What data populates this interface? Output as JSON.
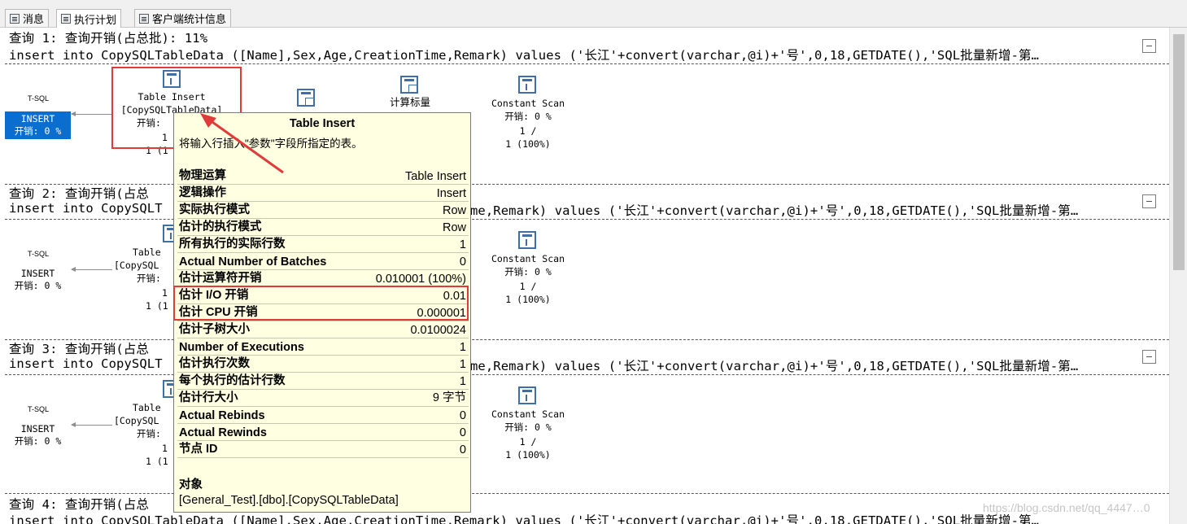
{
  "tabs": [
    {
      "label": "消息",
      "icon": "messages-icon"
    },
    {
      "label": "执行计划",
      "icon": "execution-plan-icon"
    },
    {
      "label": "客户端统计信息",
      "icon": "client-stats-icon"
    }
  ],
  "queries": [
    {
      "title": "查询 1: 查询开销(占总批): 11%",
      "sql": "insert into CopySQLTableData ([Name],Sex,Age,CreationTime,Remark) values ('长江'+convert(varchar,@i)+'号',0,18,GETDATE(),'SQL批量新增-第…"
    },
    {
      "title": "查询 2: 查询开销(占总",
      "sql_left": "insert into CopySQLT",
      "sql_right": "me,Remark) values ('长江'+convert(varchar,@i)+'号',0,18,GETDATE(),'SQL批量新增-第…"
    },
    {
      "title": "查询 3: 查询开销(占总",
      "sql_left": "insert into CopySQLT",
      "sql_right": "me,Remark) values ('长江'+convert(varchar,@i)+'号',0,18,GETDATE(),'SQL批量新增-第…"
    },
    {
      "title": "查询 4: 查询开销(占总",
      "sql_left": "insert into CopySQLTableData ([Name],Sex,Age,CreationTime,Remark) values ('长江'+convert(varchar,@i)+'号',0,18,GETDATE(),'SQL批量新增-第…"
    }
  ],
  "plan": {
    "tsql": "T-SQL",
    "insert": "INSERT",
    "insert_cost": "开销: 0 %",
    "table_insert_name": "Table Insert",
    "table_insert_obj": "[CopySQLTableData]",
    "table_insert_short": "Table",
    "table_insert_obj_short": "[CopySQL",
    "table_insert_cost": "开销:",
    "table_insert_rows_a": "1",
    "table_insert_rows_b": "1 (1",
    "compute_scalar": "计算标量",
    "constant_scan": "Constant Scan",
    "constant_cost": "开销: 0 %",
    "constant_rows_a": "1 /",
    "constant_rows_b": "1 (100%)"
  },
  "tooltip": {
    "title": "Table Insert",
    "description": "将输入行插入\"参数\"字段所指定的表。",
    "rows": [
      {
        "k": "物理运算",
        "v": "Table Insert"
      },
      {
        "k": "逻辑操作",
        "v": "Insert"
      },
      {
        "k": "实际执行模式",
        "v": "Row"
      },
      {
        "k": "估计的执行模式",
        "v": "Row"
      },
      {
        "k": "所有执行的实际行数",
        "v": "1"
      },
      {
        "k": "Actual Number of Batches",
        "v": "0"
      },
      {
        "k": "估计运算符开销",
        "v": "0.010001 (100%)"
      },
      {
        "k": "估计 I/O 开销",
        "v": "0.01"
      },
      {
        "k": "估计 CPU 开销",
        "v": "0.000001"
      },
      {
        "k": "估计子树大小",
        "v": "0.0100024"
      },
      {
        "k": "Number of Executions",
        "v": "1"
      },
      {
        "k": "估计执行次数",
        "v": "1"
      },
      {
        "k": "每个执行的估计行数",
        "v": "1"
      },
      {
        "k": "估计行大小",
        "v": "9 字节"
      },
      {
        "k": "Actual Rebinds",
        "v": "0"
      },
      {
        "k": "Actual Rewinds",
        "v": "0"
      },
      {
        "k": "节点 ID",
        "v": "0"
      }
    ],
    "object_label": "对象",
    "object_value": "[General_Test].[dbo].[CopySQLTableData]"
  },
  "watermark": "https://blog.csdn.net/qq_4447…0"
}
